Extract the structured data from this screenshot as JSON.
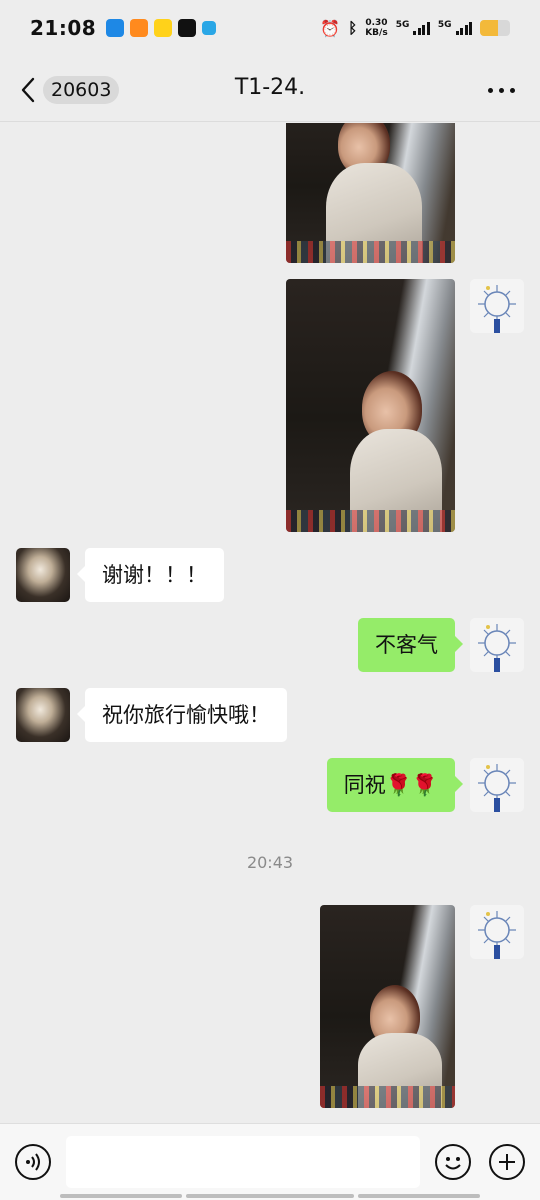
{
  "status_bar": {
    "time": "21:08",
    "net_speed_value": "0.30",
    "net_speed_unit": "KB/s",
    "network_1": "5G",
    "network_2": "5G",
    "battery_level": 0.6,
    "app_icons": [
      "qq-icon",
      "taobao-icon",
      "app-yellow-icon",
      "tiktok-icon",
      "app-blue-icon"
    ]
  },
  "header": {
    "back_count": "20603",
    "title": "T1-24."
  },
  "messages": {
    "thanks": "谢谢！！！",
    "you_are_welcome": "不客气",
    "happy_travels": "祝你旅行愉快哦！",
    "same_to_you": "同祝🌹🌹",
    "timestamp": "20:43"
  },
  "input": {
    "placeholder": ""
  },
  "colors": {
    "background": "#ededed",
    "bubble_sent": "#95ec69",
    "bubble_received": "#ffffff"
  }
}
